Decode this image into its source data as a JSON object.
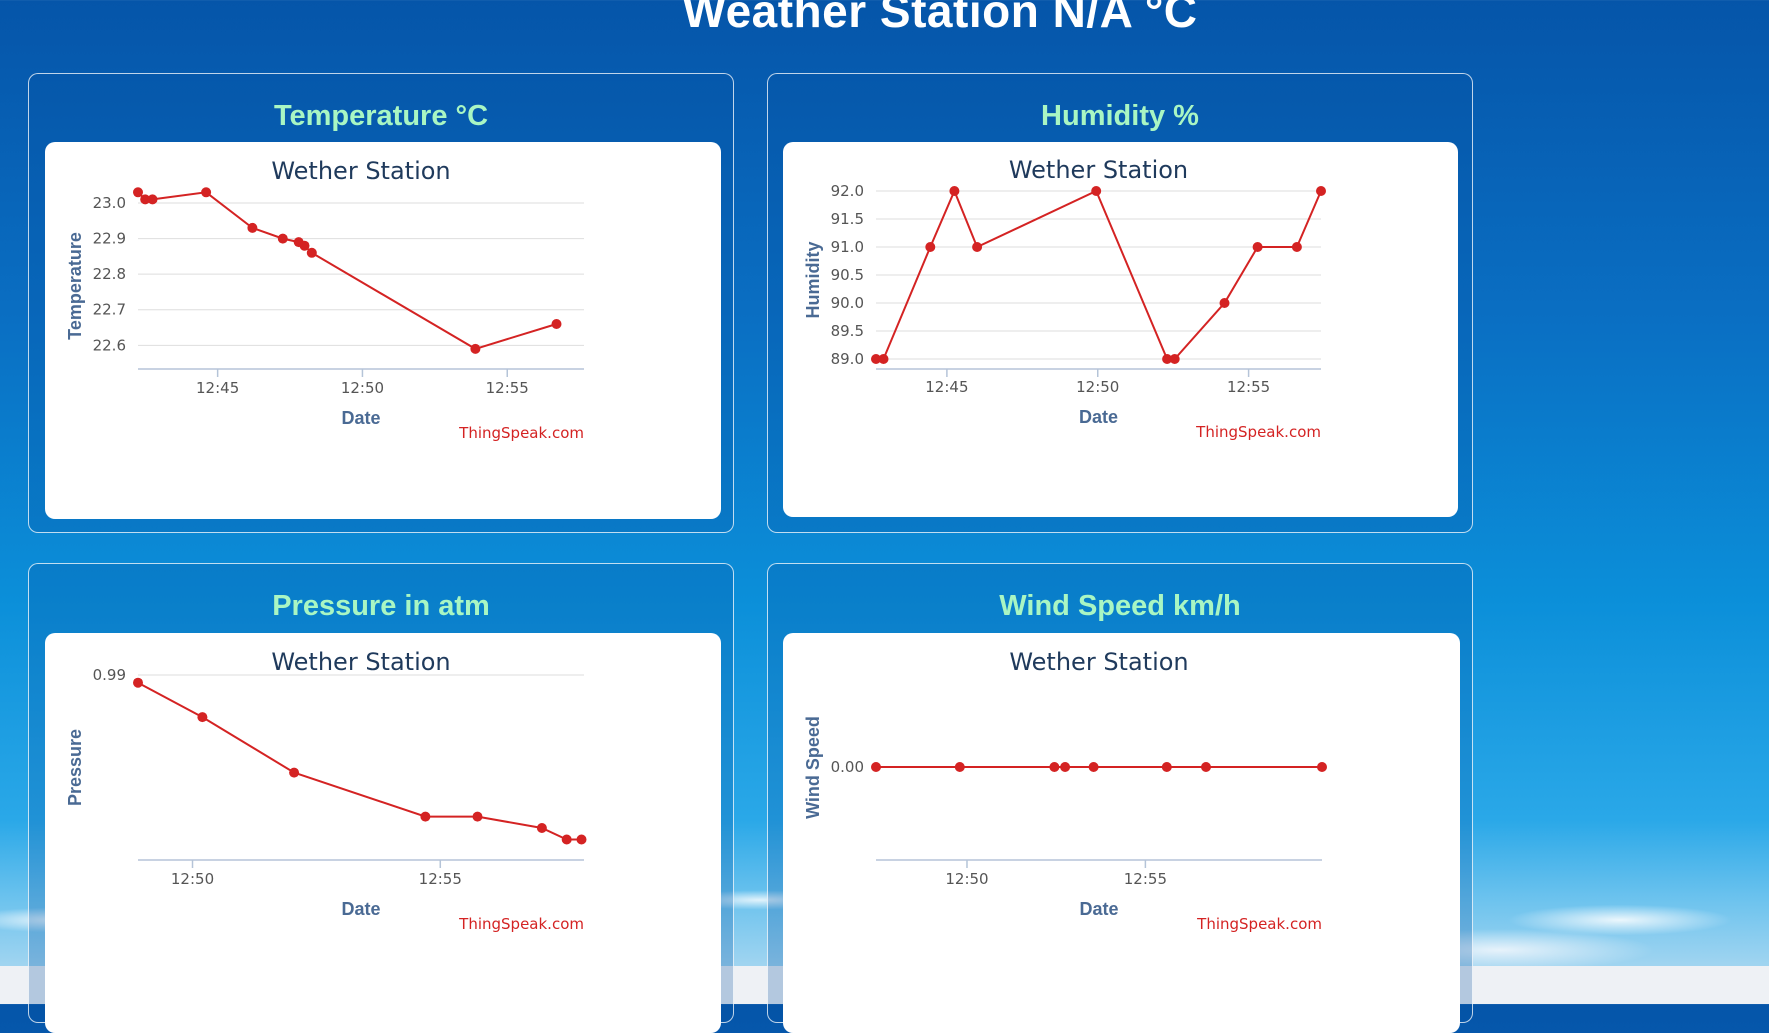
{
  "page": {
    "title": "Weather Station N/A °C"
  },
  "colors": {
    "series": "#d42323",
    "panel_heading": "#a9f6c3",
    "background": "#0a6fc3"
  },
  "chart_data": [
    {
      "type": "line",
      "panel_title": "Temperature °C",
      "title": "Wether Station",
      "xlabel": "Date",
      "ylabel": "Temperature",
      "credit": "ThingSpeak.com",
      "grid": true,
      "x_domain_min": [
        12,
        42.25
      ],
      "x_domain_max": [
        12,
        57.65
      ],
      "x_ticks": [
        "12:45",
        "12:50",
        "12:55"
      ],
      "y_ticks": [
        "22.6",
        "22.7",
        "22.8",
        "22.9",
        "23.0"
      ],
      "ylim": [
        22.57,
        23.0
      ],
      "series": [
        {
          "x": [
            "12:42",
            "12:42",
            "12:43",
            "12:44",
            "12:46",
            "12:47",
            "12:48",
            "12:48",
            "12:48",
            "12:54",
            "12:56"
          ],
          "xm": [
            42.25,
            42.5,
            42.75,
            44.6,
            46.2,
            47.25,
            47.8,
            48.0,
            48.25,
            53.9,
            56.7
          ],
          "values": [
            23.03,
            23.01,
            23.01,
            23.03,
            22.93,
            22.9,
            22.89,
            22.88,
            22.86,
            22.59,
            22.66
          ]
        }
      ]
    },
    {
      "type": "line",
      "panel_title": "Humidity %",
      "title": "Wether Station",
      "xlabel": "Date",
      "ylabel": "Humidity",
      "credit": "ThingSpeak.com",
      "grid": true,
      "x_domain_min": [
        12,
        42.65
      ],
      "x_domain_max": [
        12,
        57.4
      ],
      "x_ticks": [
        "12:45",
        "12:50",
        "12:55"
      ],
      "y_ticks": [
        "89.0",
        "89.5",
        "90.0",
        "90.5",
        "91.0",
        "91.5",
        "92.0"
      ],
      "ylim": [
        89.0,
        92.0
      ],
      "series": [
        {
          "xm": [
            42.65,
            42.9,
            44.45,
            45.25,
            46.0,
            49.95,
            52.3,
            52.55,
            54.2,
            55.3,
            56.6,
            57.4
          ],
          "values": [
            89.0,
            89.0,
            91.0,
            92.0,
            91.0,
            92.0,
            89.0,
            89.0,
            90.0,
            91.0,
            91.0,
            92.0
          ]
        }
      ]
    },
    {
      "type": "line",
      "panel_title": "Pressure in atm",
      "title": "Wether Station",
      "xlabel": "Date",
      "ylabel": "Pressure",
      "credit": "ThingSpeak.com",
      "grid": true,
      "x_domain_min": [
        12,
        48.9
      ],
      "x_domain_max": [
        12,
        57.9
      ],
      "x_ticks": [
        "12:50",
        "12:55"
      ],
      "y_ticks": [
        "0.99"
      ],
      "ylim": [
        0.9808,
        0.99
      ],
      "series": [
        {
          "xm": [
            48.9,
            50.2,
            52.05,
            54.7,
            55.75,
            57.05,
            57.55,
            57.85
          ],
          "values": [
            0.9896,
            0.9878,
            0.9849,
            0.9826,
            0.9826,
            0.982,
            0.9814,
            0.9814
          ]
        }
      ]
    },
    {
      "type": "line",
      "panel_title": "Wind Speed km/h",
      "title": "Wether Station",
      "xlabel": "Date",
      "ylabel": "Wind Speed",
      "credit": "ThingSpeak.com",
      "grid": false,
      "x_domain_min": [
        12,
        47.45
      ],
      "x_domain_max": [
        12,
        59.95
      ],
      "x_ticks": [
        "12:50",
        "12:55"
      ],
      "y_ticks": [
        "0.00"
      ],
      "ylim": [
        -1,
        1
      ],
      "series": [
        {
          "xm": [
            47.45,
            49.8,
            52.45,
            52.75,
            53.55,
            55.6,
            56.7,
            59.95
          ],
          "values": [
            0,
            0,
            0,
            0,
            0,
            0,
            0,
            0
          ]
        }
      ]
    }
  ]
}
